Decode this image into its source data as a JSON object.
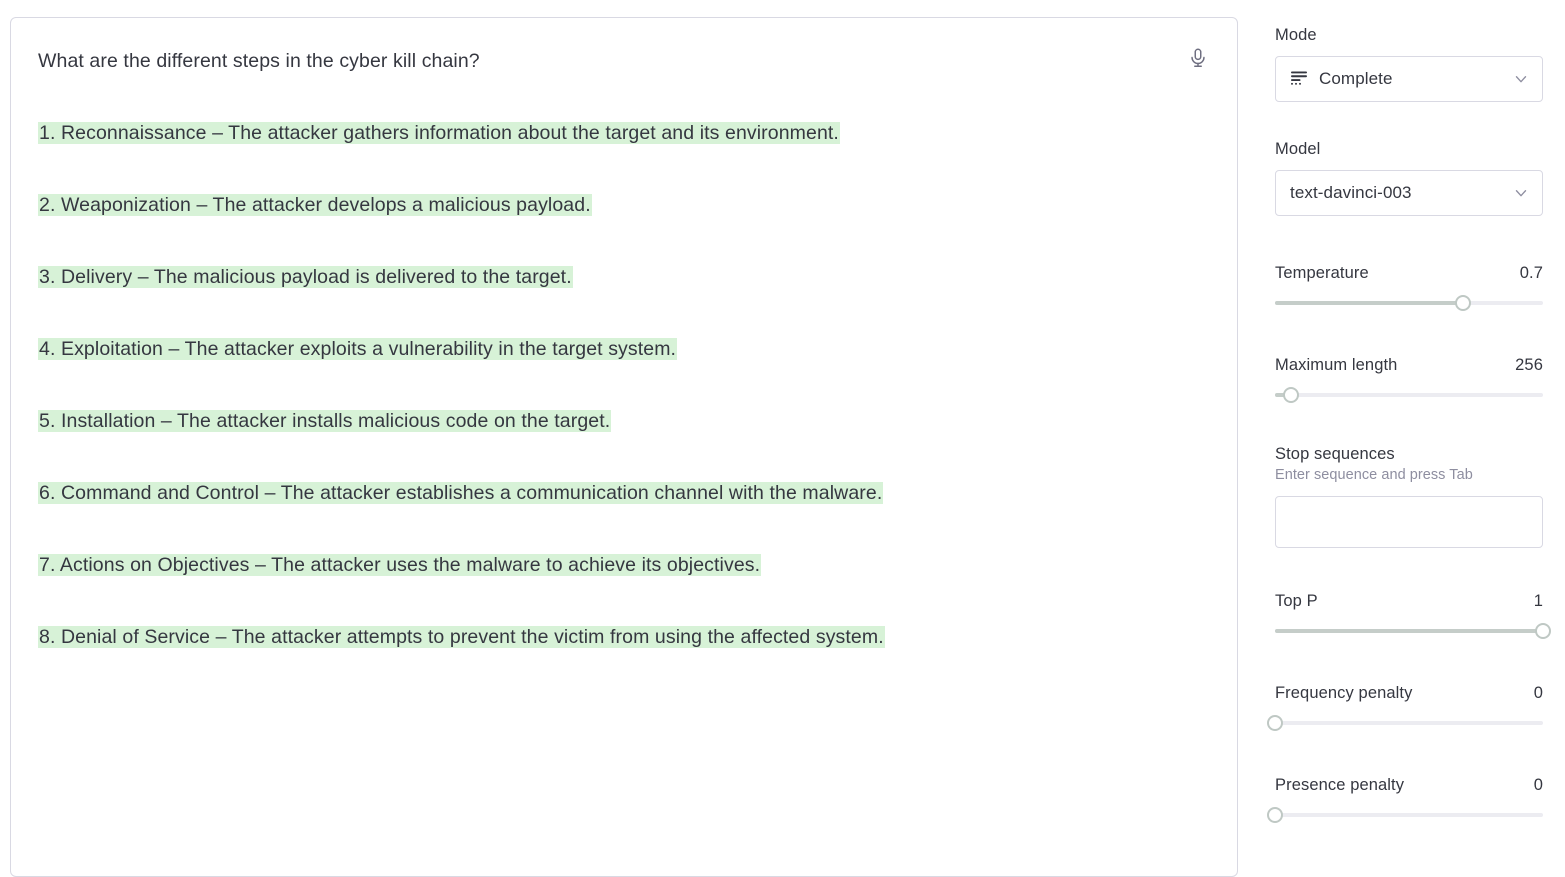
{
  "editor": {
    "prompt": "What are the different steps in the cyber kill chain?",
    "mic_icon": "microphone-icon",
    "completion_lines": [
      "1. Reconnaissance – The attacker gathers information about the target and its environment.",
      "2. Weaponization – The attacker develops a malicious payload.",
      "3. Delivery – The malicious payload is delivered to the target.",
      "4. Exploitation – The attacker exploits a vulnerability in the target system.",
      "5. Installation – The attacker installs malicious code on the target.",
      "6. Command and Control – The attacker establishes a communication channel with the malware.",
      "7. Actions on Objectives – The attacker uses the malware to achieve its objectives.",
      "8. Denial of Service – The attacker attempts to prevent the victim from using the affected system."
    ],
    "highlight_color": "#d7f2d7",
    "text_color": "#353740"
  },
  "sidebar": {
    "mode": {
      "label": "Mode",
      "value": "Complete",
      "icon": "complete-mode-icon",
      "chevron": "chevron-down-icon"
    },
    "model": {
      "label": "Model",
      "value": "text-davinci-003",
      "chevron": "chevron-down-icon"
    },
    "temperature": {
      "label": "Temperature",
      "value": "0.7",
      "percent": 70
    },
    "maximum_length": {
      "label": "Maximum length",
      "value": "256",
      "percent": 6
    },
    "stop_sequences": {
      "label": "Stop sequences",
      "hint": "Enter sequence and press Tab",
      "value": "",
      "placeholder": ""
    },
    "top_p": {
      "label": "Top P",
      "value": "1",
      "percent": 100
    },
    "frequency_penalty": {
      "label": "Frequency penalty",
      "value": "0",
      "percent": 0
    },
    "presence_penalty": {
      "label": "Presence penalty",
      "value": "0",
      "percent": 0
    }
  }
}
